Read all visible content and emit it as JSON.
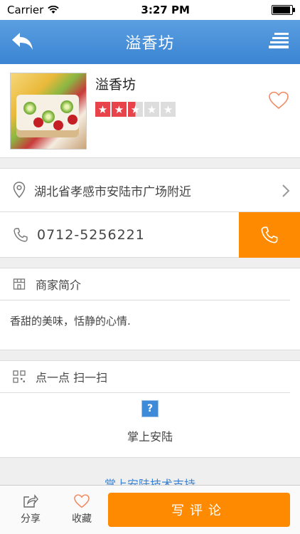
{
  "status": {
    "carrier": "Carrier",
    "time": "3:27 PM"
  },
  "nav": {
    "title": "溢香坊"
  },
  "shop": {
    "name": "溢香坊",
    "rating": 2.5,
    "rating_max": 5
  },
  "address": {
    "text": "湖北省孝感市安陆市广场附近"
  },
  "phone": {
    "number": "0712-5256221"
  },
  "intro": {
    "heading": "商家简介",
    "text": "香甜的美味，恬静的心情."
  },
  "qr": {
    "heading": "点一点 扫一扫",
    "icon_char": "?",
    "label": "掌上安陆"
  },
  "footer": {
    "support": "掌上安陆技术支持"
  },
  "tabbar": {
    "share": "分享",
    "favorite": "收藏",
    "review": "写评论"
  },
  "colors": {
    "nav_blue": "#3a84d3",
    "accent_orange": "#fd8a00",
    "star_red": "#e8434b"
  }
}
